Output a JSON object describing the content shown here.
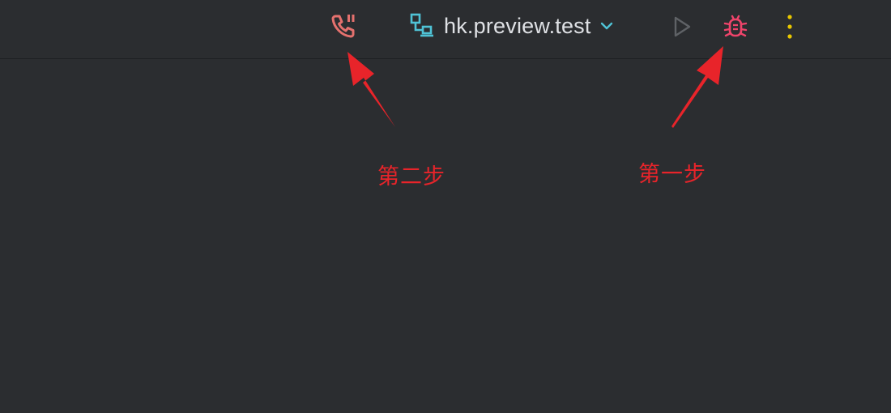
{
  "toolbar": {
    "run_configuration": {
      "label": "hk.preview.test",
      "icon": "device-configuration-icon"
    },
    "buttons": [
      {
        "name": "phone-call-button",
        "icon": "phone-pause-icon",
        "color": "#e5716e"
      },
      {
        "name": "run-button",
        "icon": "play-triangle-icon",
        "color": "#5f6266",
        "enabled": false
      },
      {
        "name": "debug-button",
        "icon": "bug-icon",
        "color": "#f0446b"
      },
      {
        "name": "more-button",
        "icon": "vertical-dots-icon",
        "color": "#e8c700"
      }
    ]
  },
  "annotations": {
    "step_two": "第二步",
    "step_one": "第一步",
    "arrow_color": "#e8242a"
  },
  "colors": {
    "background": "#2b2d30",
    "accent_cyan": "#4fc3d6",
    "text": "#dfe1e5"
  }
}
